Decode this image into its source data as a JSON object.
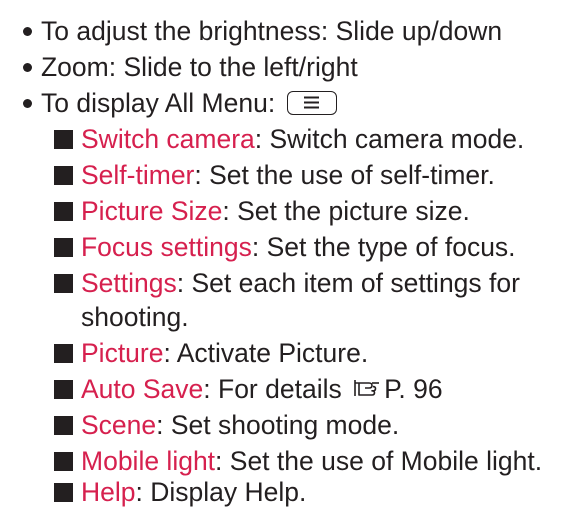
{
  "bullets": [
    {
      "text": "To adjust the brightness: Slide up/down"
    },
    {
      "text": "Zoom: Slide to the left/right"
    },
    {
      "text": "To display All Menu:",
      "key_icon": "menu-icon"
    }
  ],
  "menu_items": [
    {
      "term": "Switch camera",
      "desc": ": Switch camera mode."
    },
    {
      "term": "Self-timer",
      "desc": ": Set the use of self-timer."
    },
    {
      "term": "Picture Size",
      "desc": ": Set the picture size."
    },
    {
      "term": "Focus settings",
      "desc": ": Set the type of focus."
    },
    {
      "term": "Settings",
      "desc": ": Set each item of settings for",
      "desc_cont": "shooting."
    },
    {
      "term": "Picture",
      "desc": ": Activate Picture."
    },
    {
      "term": "Auto Save",
      "desc": ": For details",
      "ref_icon": "pointing-hand-icon",
      "ref_text": "P. 96"
    },
    {
      "term": "Scene",
      "desc": ": Set shooting mode."
    },
    {
      "term": "Mobile light",
      "desc": ": Set the use of Mobile light."
    },
    {
      "term": "Help",
      "desc": ": Display Help."
    }
  ],
  "colors": {
    "text": "#231f20",
    "term": "#d6204e"
  }
}
